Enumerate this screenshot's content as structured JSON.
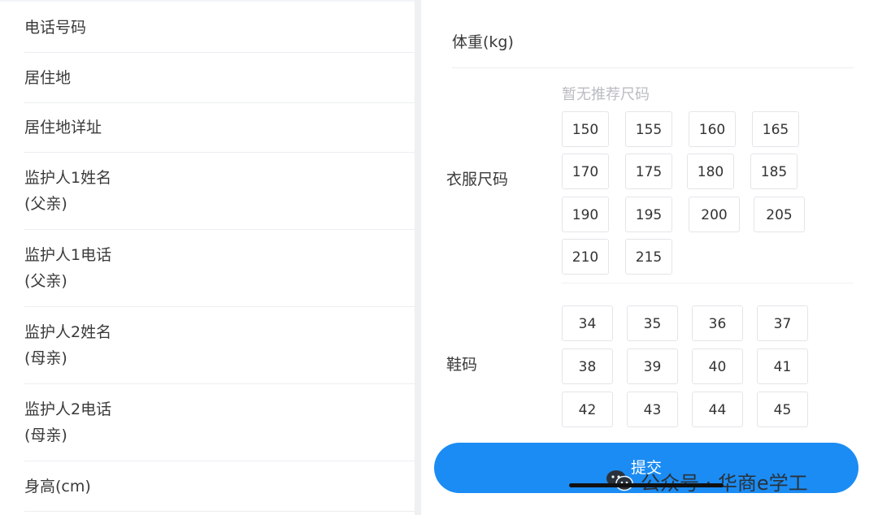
{
  "left_form": {
    "rows": [
      {
        "lines": [
          "电话号码"
        ]
      },
      {
        "lines": [
          "居住地"
        ]
      },
      {
        "lines": [
          "居住地详址"
        ]
      },
      {
        "lines": [
          "监护人1姓名",
          "(父亲)"
        ]
      },
      {
        "lines": [
          "监护人1电话",
          "(父亲)"
        ]
      },
      {
        "lines": [
          "监护人2姓名",
          "(母亲)"
        ]
      },
      {
        "lines": [
          "监护人2电话",
          "(母亲)"
        ]
      },
      {
        "lines": [
          "身高(cm)"
        ]
      }
    ]
  },
  "right_form": {
    "weight_label": "体重(kg)",
    "clothing": {
      "label": "衣服尺码",
      "hint": "暂无推荐尺码",
      "sizes": [
        "150",
        "155",
        "160",
        "165",
        "170",
        "175",
        "180",
        "185",
        "190",
        "195",
        "200",
        "205",
        "210",
        "215"
      ]
    },
    "shoes": {
      "label": "鞋码",
      "sizes": [
        "34",
        "35",
        "36",
        "37",
        "38",
        "39",
        "40",
        "41",
        "42",
        "43",
        "44",
        "45"
      ]
    },
    "submit_label": "提交"
  },
  "watermark": {
    "text": "公众号 · 华商e学工",
    "icon": "wechat-icon"
  },
  "colors": {
    "accent": "#1b8cf3",
    "divider": "#eceef1",
    "hint": "#b9bcc2"
  }
}
